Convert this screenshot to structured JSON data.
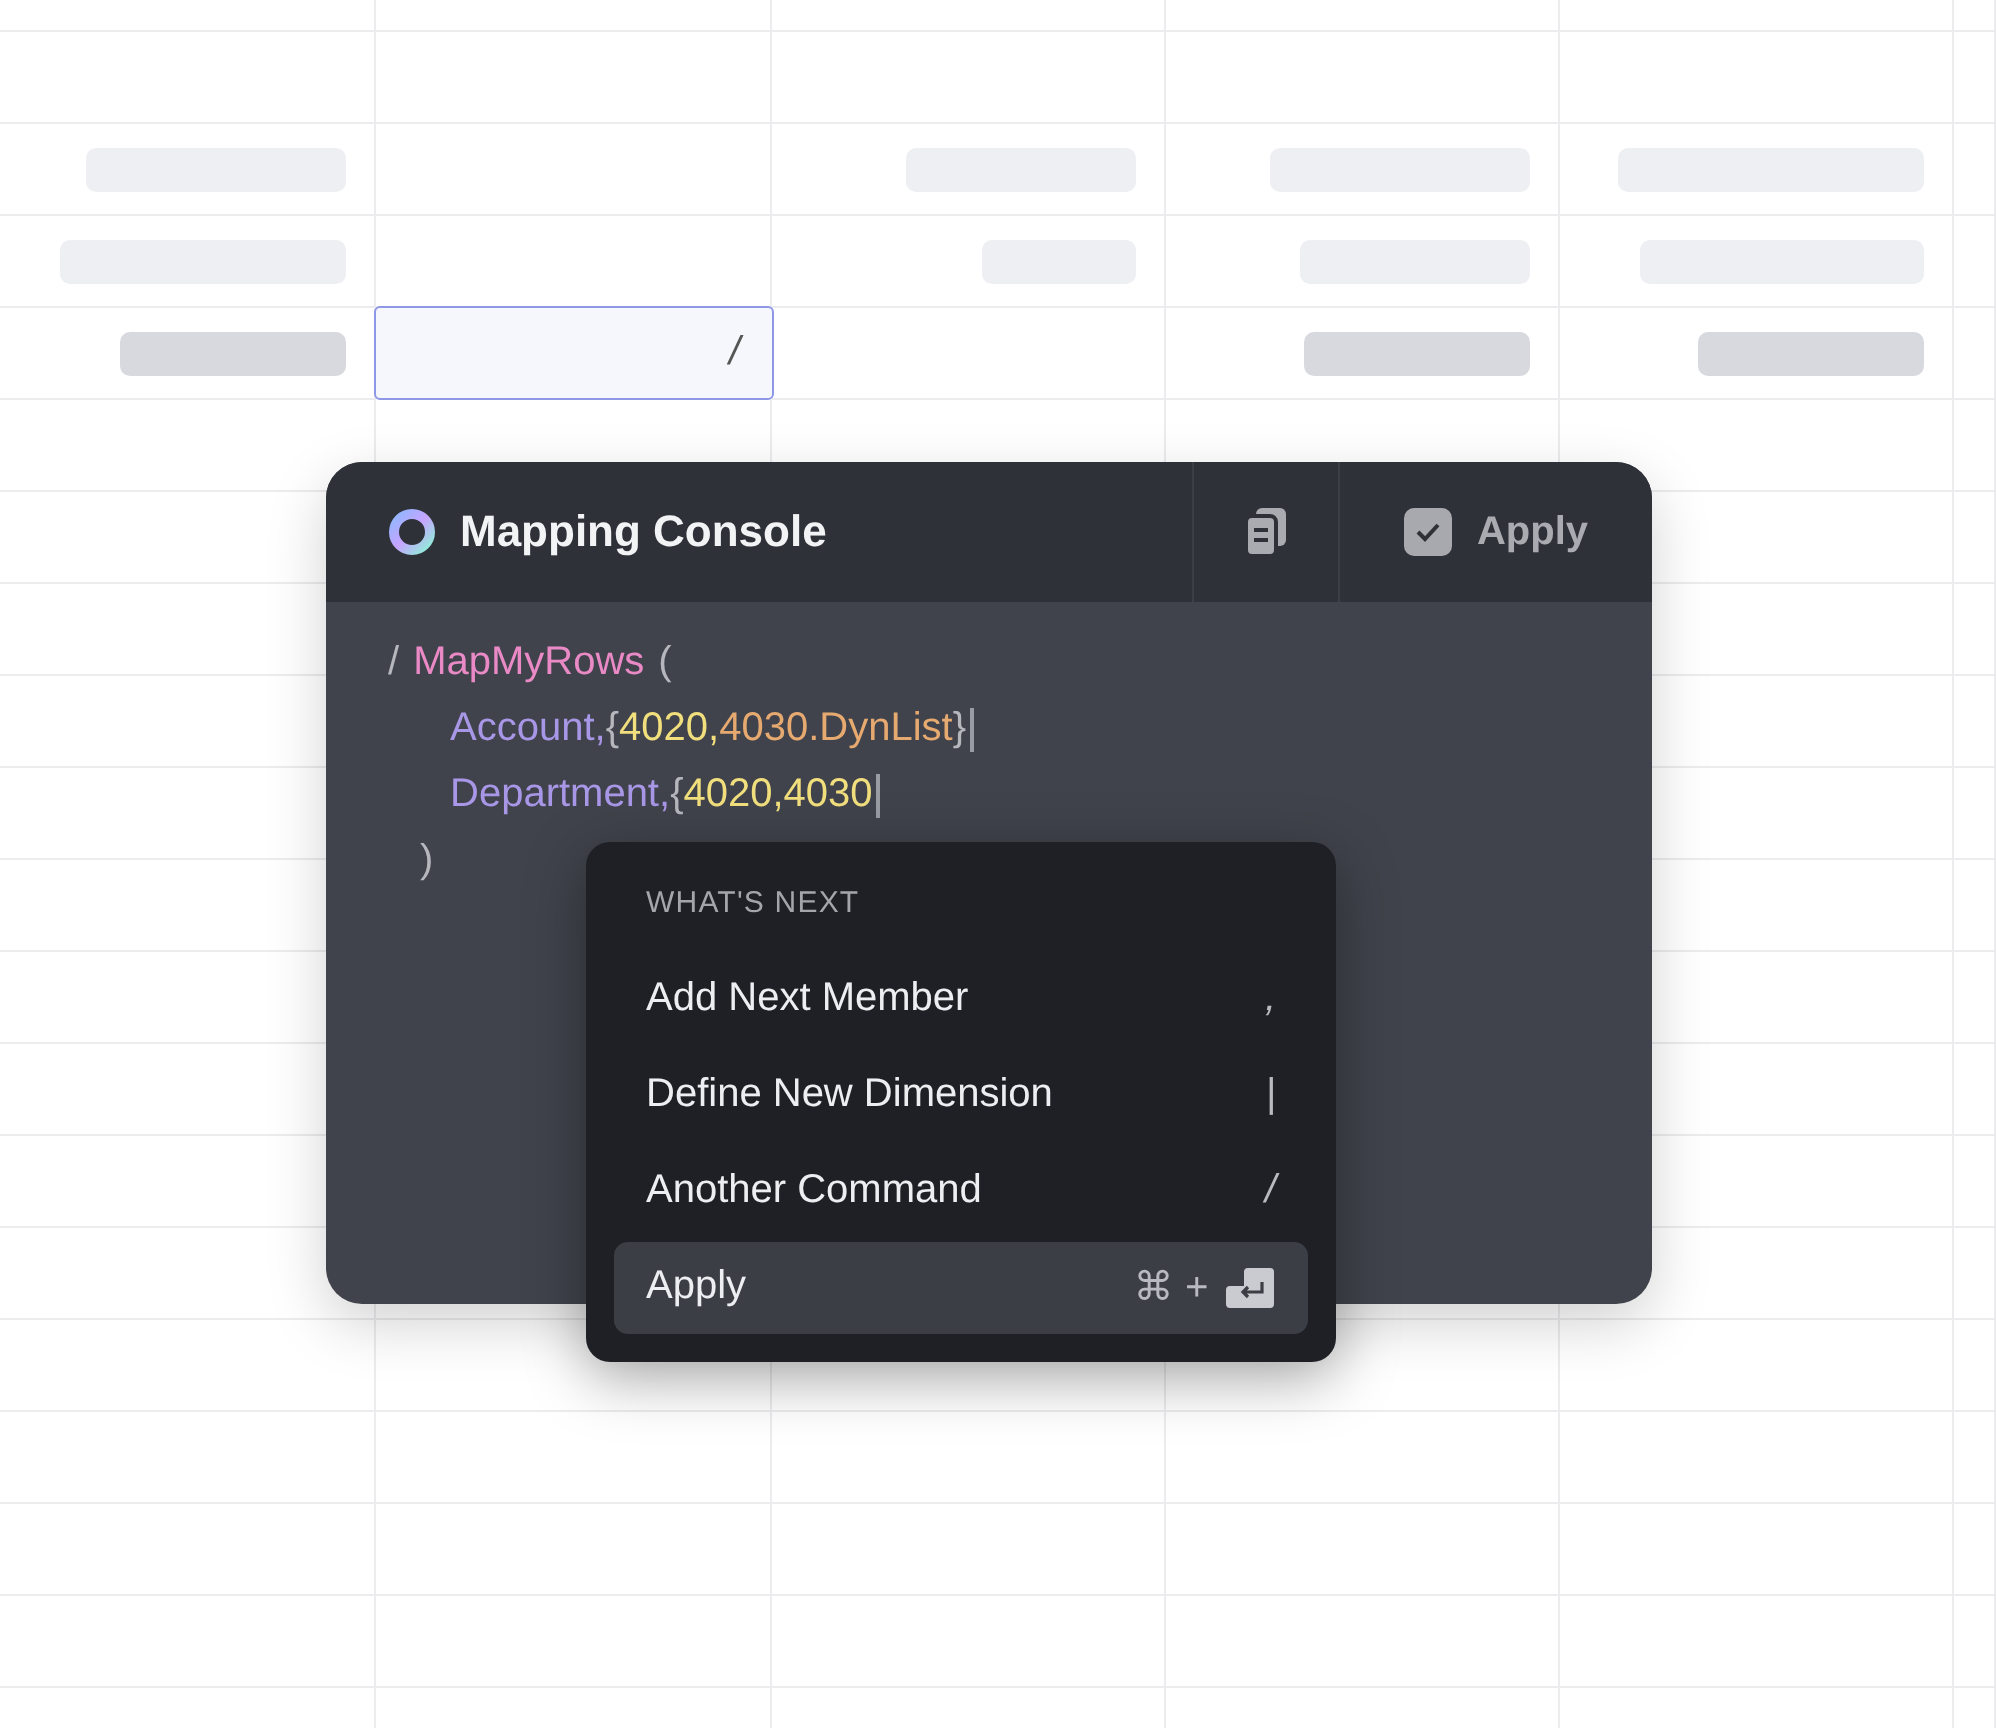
{
  "sheet": {
    "rows": [
      {
        "cells": [
          {
            "kind": "skeleton",
            "dark": false
          },
          {
            "kind": "empty"
          },
          {
            "kind": "skeleton",
            "dark": false
          },
          {
            "kind": "skeleton",
            "dark": false
          },
          {
            "kind": "skeleton",
            "dark": false
          }
        ]
      },
      {
        "cells": [
          {
            "kind": "skeleton",
            "dark": false
          },
          {
            "kind": "empty"
          },
          {
            "kind": "skeleton",
            "dark": false
          },
          {
            "kind": "skeleton",
            "dark": false
          },
          {
            "kind": "skeleton",
            "dark": false
          }
        ]
      },
      {
        "cells": [
          {
            "kind": "skeleton",
            "dark": true
          },
          {
            "kind": "input",
            "value": "/"
          },
          {
            "kind": "empty"
          },
          {
            "kind": "skeleton",
            "dark": true
          },
          {
            "kind": "skeleton",
            "dark": true
          }
        ]
      }
    ]
  },
  "console": {
    "title": "Mapping Console",
    "apply": {
      "label": "Apply",
      "checked": true
    },
    "code": [
      {
        "kind": "line",
        "tokens": [
          {
            "kind": "punct",
            "text": "/"
          },
          {
            "kind": "fn",
            "text": "MapMyRows"
          },
          {
            "kind": "punct",
            "text": "("
          }
        ],
        "children": [
          {
            "kind": "line",
            "cursor": true,
            "tokens": [
              {
                "kind": "dim",
                "text": "Account,"
              },
              {
                "kind": "punct",
                "text": "{"
              },
              {
                "kind": "num",
                "text": "4020,"
              },
              {
                "kind": "str",
                "text": "4030.DynList"
              },
              {
                "kind": "punct",
                "text": "}"
              }
            ]
          },
          {
            "kind": "line",
            "cursor": true,
            "tokens": [
              {
                "kind": "dim",
                "text": "Department,"
              },
              {
                "kind": "punct",
                "text": "{"
              },
              {
                "kind": "num",
                "text": "4020,4030"
              }
            ]
          }
        ]
      },
      {
        "kind": "close",
        "tokens": [
          {
            "kind": "punct",
            "text": ")"
          }
        ]
      }
    ]
  },
  "menu": {
    "heading": "WHAT'S NEXT",
    "items": [
      {
        "label": "Add Next Member",
        "shortcut": ",",
        "selected": false
      },
      {
        "label": "Define New Dimension",
        "shortcut": "|",
        "selected": false
      },
      {
        "label": "Another Command",
        "shortcut": "/",
        "selected": false
      },
      {
        "label": "Apply",
        "shortcut": "⌘ +",
        "enter_key": true,
        "selected": true
      }
    ]
  }
}
